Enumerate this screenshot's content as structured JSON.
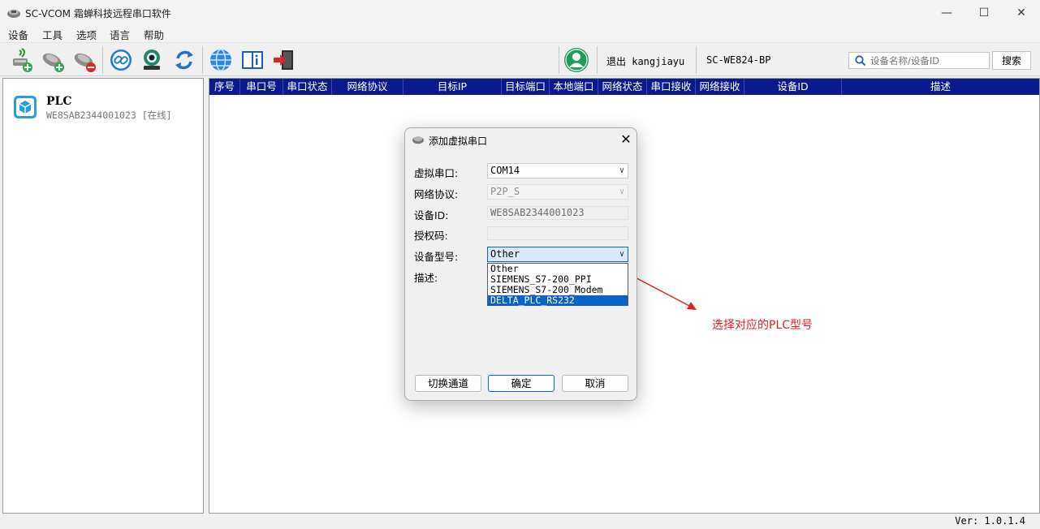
{
  "window": {
    "title": "SC-VCOM 霜蝉科技远程串口软件",
    "minimize": "—",
    "maximize": "☐",
    "close": "✕"
  },
  "menu": [
    "设备",
    "工具",
    "选项",
    "语言",
    "帮助"
  ],
  "toolbar": {
    "logout_text": "退出 kangjiayu",
    "device_model": "SC-WE824-BP",
    "search_placeholder": "设备名称/设备ID",
    "search_button": "搜索"
  },
  "device_list": [
    {
      "name": "PLC",
      "sub": "WE8SAB2344001023 [在线]"
    }
  ],
  "table": {
    "headers": [
      "序号",
      "串口号",
      "串口状态",
      "网络协议",
      "目标IP",
      "目标端口",
      "本地端口",
      "网络状态",
      "串口接收",
      "网络接收",
      "设备ID",
      "描述"
    ],
    "header_bg": "#0a1a8c"
  },
  "status": {
    "version": "Ver: 1.0.1.4"
  },
  "dialog": {
    "title": "添加虚拟串口",
    "close": "✕",
    "fields": {
      "virtual_port_label": "虚拟串口:",
      "virtual_port_value": "COM14",
      "protocol_label": "网络协议:",
      "protocol_value": "P2P_S",
      "device_id_label": "设备ID:",
      "device_id_value": "WE8SAB2344001023",
      "auth_label": "授权码:",
      "auth_value": "",
      "model_label": "设备型号:",
      "model_value": "Other",
      "desc_label": "描述:"
    },
    "model_options": [
      "Other",
      "SIEMENS_S7-200_PPI",
      "SIEMENS_S7-200_Modem",
      "DELTA_PLC_RS232"
    ],
    "model_highlighted": "DELTA_PLC_RS232",
    "buttons": {
      "switch": "切换通道",
      "ok": "确定",
      "cancel": "取消"
    }
  },
  "annotation": {
    "text": "选择对应的PLC型号",
    "color": "#e02020"
  },
  "colors": {
    "accent": "#0b63c9",
    "online_green": "#1e9e5a"
  }
}
